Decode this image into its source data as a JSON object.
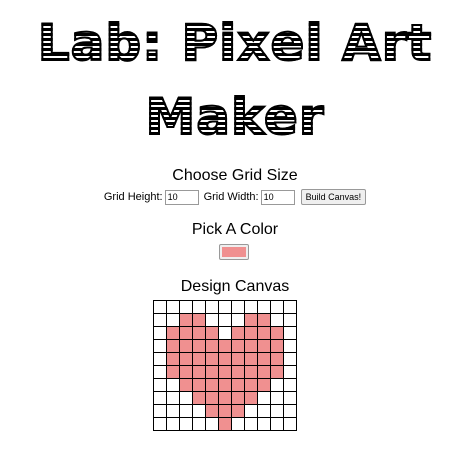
{
  "title": {
    "line1": "Lab: Pixel Art",
    "line2": "Maker"
  },
  "grid_size": {
    "heading": "Choose Grid Size",
    "height_label": "Grid Height:",
    "height_value": "10",
    "width_label": "Grid Width:",
    "width_value": "10",
    "build_button": "Build Canvas!"
  },
  "color": {
    "heading": "Pick A Color",
    "value": "#f09090"
  },
  "canvas": {
    "heading": "Design Canvas",
    "rows": 10,
    "cols": 11,
    "fill_color": "#f09090",
    "filled": [
      [
        0,
        0,
        0,
        0,
        0,
        0,
        0,
        0,
        0,
        0,
        0
      ],
      [
        0,
        0,
        1,
        1,
        0,
        0,
        0,
        1,
        1,
        0,
        0
      ],
      [
        0,
        1,
        1,
        1,
        1,
        0,
        1,
        1,
        1,
        1,
        0
      ],
      [
        0,
        1,
        1,
        1,
        1,
        1,
        1,
        1,
        1,
        1,
        0
      ],
      [
        0,
        1,
        1,
        1,
        1,
        1,
        1,
        1,
        1,
        1,
        0
      ],
      [
        0,
        1,
        1,
        1,
        1,
        1,
        1,
        1,
        1,
        1,
        0
      ],
      [
        0,
        0,
        1,
        1,
        1,
        1,
        1,
        1,
        1,
        0,
        0
      ],
      [
        0,
        0,
        0,
        1,
        1,
        1,
        1,
        1,
        0,
        0,
        0
      ],
      [
        0,
        0,
        0,
        0,
        1,
        1,
        1,
        0,
        0,
        0,
        0
      ],
      [
        0,
        0,
        0,
        0,
        0,
        1,
        0,
        0,
        0,
        0,
        0
      ]
    ]
  }
}
